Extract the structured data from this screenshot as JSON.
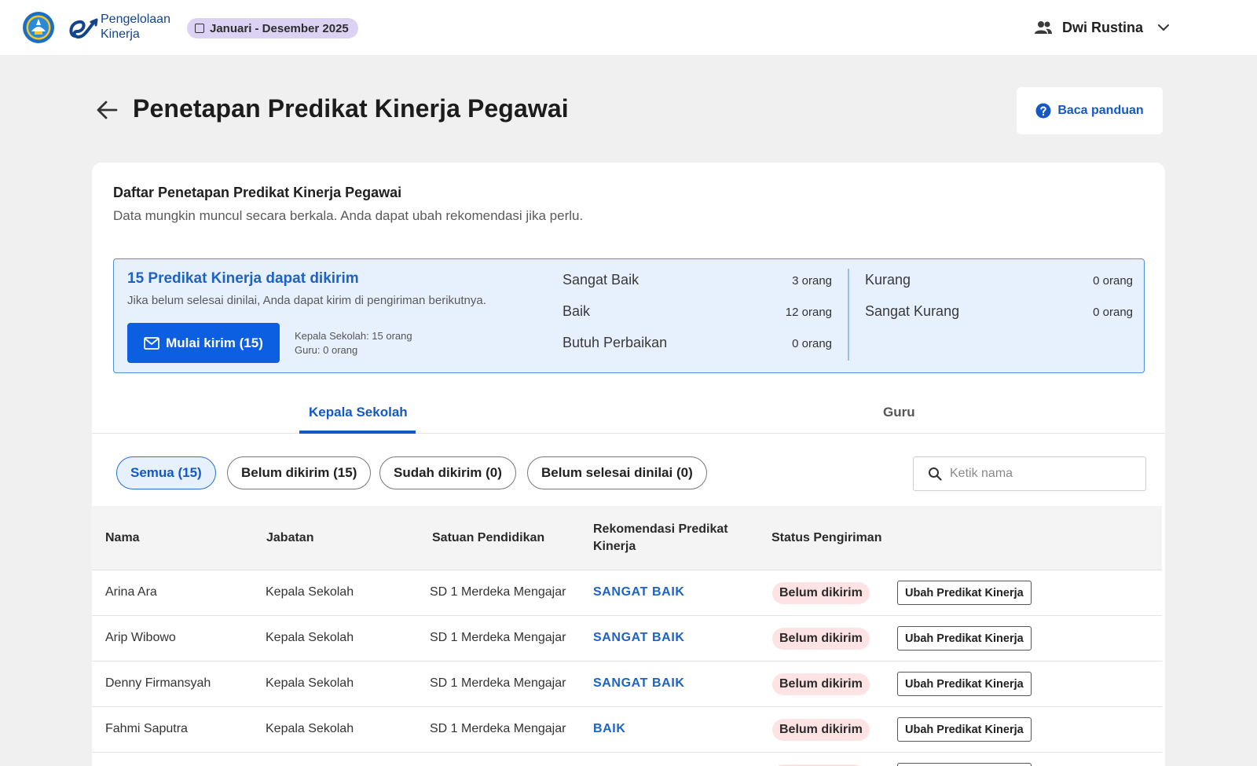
{
  "header": {
    "app_name_line1": "Pengelolaan",
    "app_name_line2": "Kinerja",
    "period": "Januari - Desember 2025",
    "user_name": "Dwi Rustina"
  },
  "page": {
    "title": "Penetapan Predikat Kinerja Pegawai",
    "guide_label": "Baca panduan"
  },
  "card": {
    "title": "Daftar Penetapan Predikat Kinerja Pegawai",
    "subtitle": "Data mungkin muncul secara berkala. Anda dapat ubah rekomendasi jika perlu."
  },
  "summary": {
    "title": "15 Predikat Kinerja dapat dikirim",
    "description": "Jika belum selesai dinilai, Anda dapat kirim di pengiriman berikutnya.",
    "send_label": "Mulai kirim (15)",
    "meta_line1": "Kepala Sekolah: 15 orang",
    "meta_line2": "Guru: 0 orang",
    "predicates": [
      {
        "label": "Sangat Baik",
        "count": "3 orang"
      },
      {
        "label": "Baik",
        "count": "12 orang"
      },
      {
        "label": "Butuh Perbaikan",
        "count": "0 orang"
      },
      {
        "label": "Kurang",
        "count": "0 orang"
      },
      {
        "label": "Sangat Kurang",
        "count": "0 orang"
      }
    ]
  },
  "tabs": [
    {
      "label": "Kepala Sekolah",
      "active": true
    },
    {
      "label": "Guru",
      "active": false
    }
  ],
  "filters": [
    {
      "label": "Semua (15)",
      "active": true
    },
    {
      "label": "Belum dikirim (15)",
      "active": false
    },
    {
      "label": "Sudah dikirim (0)",
      "active": false
    },
    {
      "label": "Belum selesai dinilai (0)",
      "active": false
    }
  ],
  "search": {
    "placeholder": "Ketik nama",
    "value": ""
  },
  "table": {
    "headers": {
      "nama": "Nama",
      "jabatan": "Jabatan",
      "satuan": "Satuan Pendidikan",
      "rekomendasi_line1": "Rekomendasi Predikat",
      "rekomendasi_line2": "Kinerja",
      "status": "Status Pengiriman"
    },
    "action_label": "Ubah Predikat Kinerja",
    "rows": [
      {
        "nama": "Arina Ara",
        "jabatan": "Kepala Sekolah",
        "satuan": "SD 1 Merdeka Mengajar",
        "predikat": "SANGAT BAIK",
        "status": "Belum dikirim"
      },
      {
        "nama": "Arip Wibowo",
        "jabatan": "Kepala Sekolah",
        "satuan": "SD 1 Merdeka Mengajar",
        "predikat": "SANGAT BAIK",
        "status": "Belum dikirim"
      },
      {
        "nama": "Denny Firmansyah",
        "jabatan": "Kepala Sekolah",
        "satuan": "SD 1 Merdeka Mengajar",
        "predikat": "SANGAT BAIK",
        "status": "Belum dikirim"
      },
      {
        "nama": "Fahmi Saputra",
        "jabatan": "Kepala Sekolah",
        "satuan": "SD 1 Merdeka Mengajar",
        "predikat": "BAIK",
        "status": "Belum dikirim"
      },
      {
        "nama": "",
        "jabatan": "",
        "satuan": "",
        "predikat": "",
        "status": ""
      }
    ]
  },
  "colors": {
    "primary": "#0b5fe0",
    "link": "#1458c8",
    "summary_bg": "#e6f1fd",
    "badge_bg": "#fde3e3",
    "period_chip": "#dcd2f3",
    "page_bg": "#f0f0f0"
  }
}
